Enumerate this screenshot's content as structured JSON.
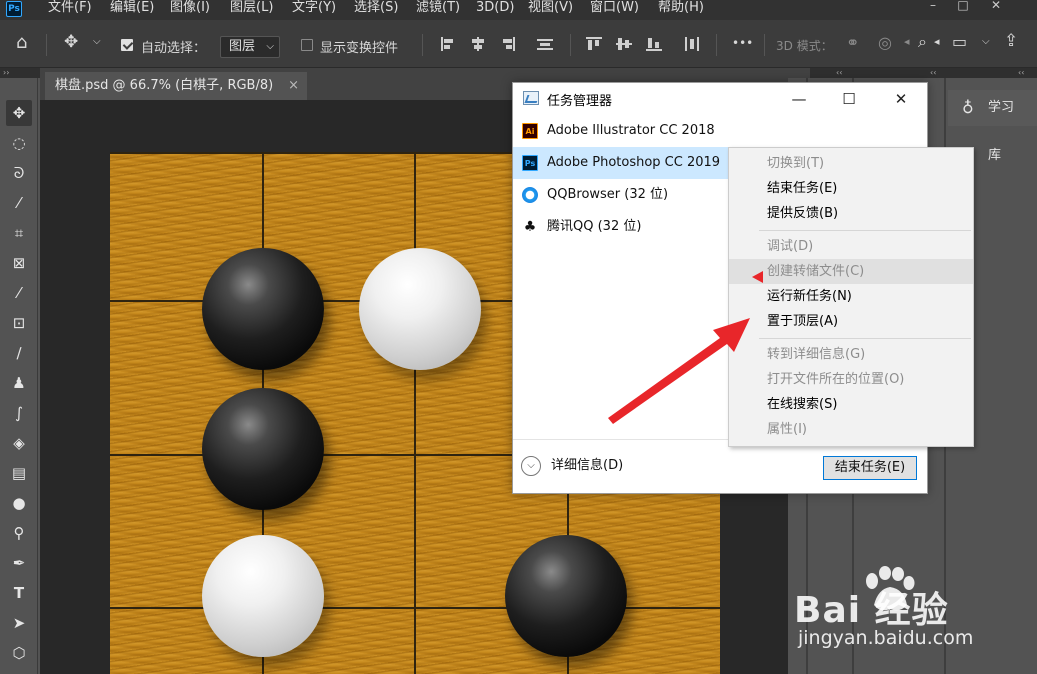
{
  "menubar": {
    "logo": "Ps",
    "items": [
      "文件(F)",
      "编辑(E)",
      "图像(I)",
      "图层(L)",
      "文字(Y)",
      "选择(S)",
      "滤镜(T)",
      "3D(D)",
      "视图(V)",
      "窗口(W)",
      "帮助(H)"
    ]
  },
  "optbar": {
    "auto_select_label": "自动选择：",
    "auto_select_checked": true,
    "layer_select_value": "图层",
    "show_transform_label": "显示变换控件",
    "show_transform_checked": false,
    "more": "•••",
    "mode_3d_label": "3D 模式："
  },
  "document": {
    "tab_title": "棋盘.psd @ 66.7% (白棋子, RGB/8)",
    "close": "×"
  },
  "right_panel": {
    "learn_label": "学习",
    "library_label": "库"
  },
  "task_manager": {
    "title": "任务管理器",
    "apps": [
      {
        "name": "Adobe Illustrator CC 2018",
        "icon": "Ai",
        "selected": false
      },
      {
        "name": "Adobe Photoshop CC 2019",
        "icon": "Ps",
        "selected": true
      },
      {
        "name": "QQBrowser (32 位)",
        "icon": "qq-browser-icon",
        "selected": false
      },
      {
        "name": "腾讯QQ (32 位)",
        "icon": "qq-penguin-icon",
        "selected": false
      }
    ],
    "details_label": "详细信息(D)",
    "end_task_label": "结束任务(E)"
  },
  "context_menu": {
    "items": [
      {
        "label": "切换到(T)",
        "enabled": false
      },
      {
        "label": "结束任务(E)",
        "enabled": true
      },
      {
        "label": "提供反馈(B)",
        "enabled": true
      },
      {
        "label": "调试(D)",
        "enabled": false
      },
      {
        "label": "创建转储文件(C)",
        "enabled": false
      },
      {
        "label": "运行新任务(N)",
        "enabled": true
      },
      {
        "label": "置于顶层(A)",
        "enabled": true
      },
      {
        "label": "转到详细信息(G)",
        "enabled": false
      },
      {
        "label": "打开文件所在的位置(O)",
        "enabled": false
      },
      {
        "label": "在线搜索(S)",
        "enabled": true
      },
      {
        "label": "属性(I)",
        "enabled": false
      }
    ]
  },
  "watermark": {
    "brand": "Bai  经验",
    "url": "jingyan.baidu.com"
  },
  "colors": {
    "arrow": "#e8262a",
    "selection": "#cce8ff",
    "board": "#c88a1c"
  }
}
